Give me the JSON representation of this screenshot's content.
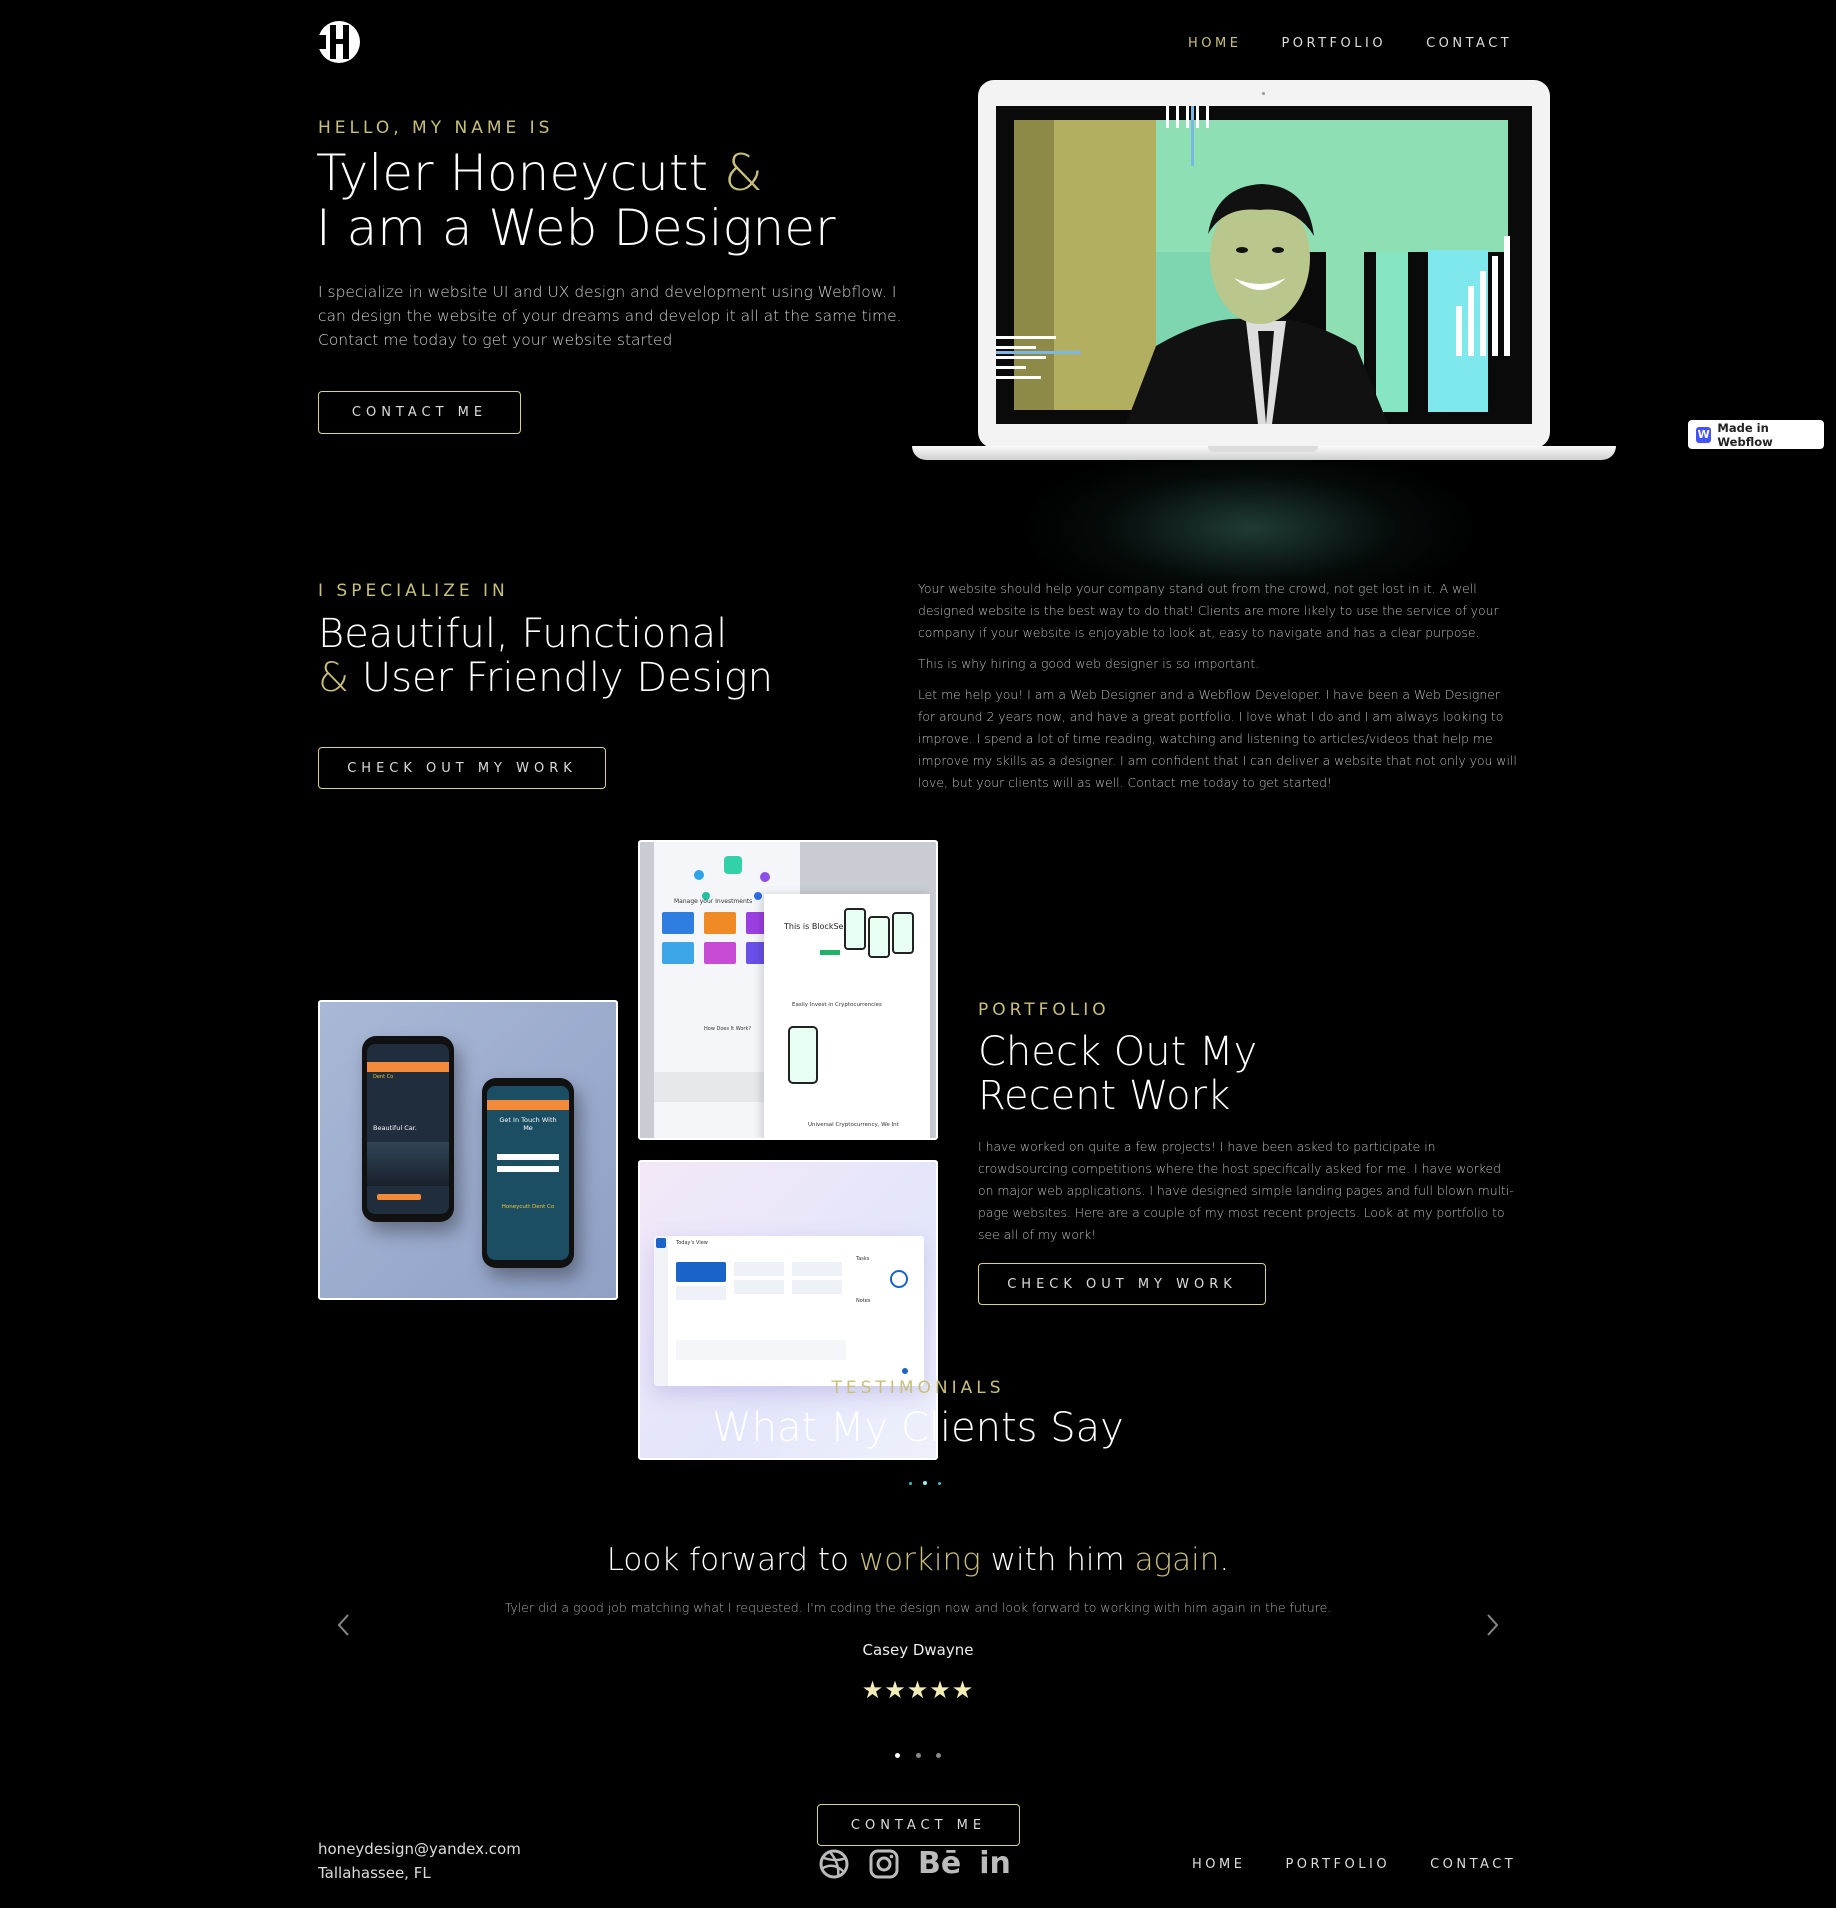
{
  "colors": {
    "background": "#000000",
    "accent": "#c8c07a",
    "button_border": "#d8d18a",
    "photo_green": "#8ee0b4",
    "photo_olive": "#b2b060"
  },
  "nav": {
    "logo_icon": "monogram-logo",
    "items": [
      {
        "label": "HOME",
        "active": true
      },
      {
        "label": "PORTFOLIO",
        "active": false
      },
      {
        "label": "CONTACT",
        "active": false
      }
    ]
  },
  "hero": {
    "eyebrow": "HELLO, MY NAME IS",
    "title_line1": "Tyler Honeycutt",
    "title_amp": "&",
    "title_line2": "I am a Web Designer",
    "intro": "I specialize in website UI and UX design and development using Webflow. I can design the website of your dreams and develop it all at the same time. Contact me today to get your website started",
    "cta": "CONTACT ME"
  },
  "webflow_badge": {
    "icon": "webflow-w-icon",
    "label": "Made in Webflow"
  },
  "specialize": {
    "eyebrow": "I SPECIALIZE IN",
    "title_line1": "Beautiful, Functional",
    "title_amp": "&",
    "title_line2": "User Friendly Design",
    "cta": "CHECK OUT MY WORK",
    "paragraphs": [
      "Your website should help your company stand out from the crowd, not get lost in it. A well designed website is the best way to do that! Clients are more likely to use the service of your company if your website is enjoyable to look at, easy to navigate and has a clear purpose.",
      "This is why hiring a good web designer is so important.",
      "Let me help you! I am a Web Designer and a Webflow Developer. I have been a Web Designer for around 2 years now, and have a great portfolio. I love what I do and I am always looking to improve. I spend a lot of time reading, watching and listening to articles/videos that help me improve my skills as a designer. I am confident that I can deliver a website that not only you will love, but your clients will as well. Contact me today to get started!"
    ]
  },
  "portfolio": {
    "eyebrow": "PORTFOLIO",
    "title_line1": "Check Out My",
    "title_line2": "Recent Work",
    "body": "I have worked on quite a few projects! I have been asked to participate in crowdsourcing competitions where the host specifically asked for me. I have worked on major web applications. I have designed simple landing pages and full blown multi-page websites. Here are a couple of my most recent projects. Look at my portfolio to see all of my work!",
    "cta": "CHECK OUT MY WORK",
    "card_blocksense": {
      "headline": "This is BlockSense",
      "sub1": "Manage your Investments",
      "sub2": "Easily Invest in Cryptocurrencies",
      "sub3": "How Does It Work?",
      "sub4": "Universal Cryptocurrency, We Int"
    },
    "card_phones": {
      "phone1_line1": "Honeycutt",
      "phone1_line2": "Dent Co",
      "phone1_text": "Beautiful Car.",
      "phone2_text": "Get In Touch With Me",
      "phone2_logo": "Honeycutt Dent Co"
    },
    "card_dashboard": {
      "title": "Today's View",
      "side": "Tasks",
      "notes": "Notes"
    }
  },
  "testimonials": {
    "eyebrow": "TESTIMONIALS",
    "title": "What My Clients Say",
    "quote_w1": "Look forward to",
    "quote_w2": "working",
    "quote_w3": "with him",
    "quote_w4": "again",
    "quote_w5": ".",
    "body": "Tyler did a good job matching what I requested. I'm coding the design now and look forward to working with him again in the future.",
    "author": "Casey Dwayne",
    "stars": "★★★★★",
    "rating": 5,
    "prev_icon": "chevron-left-icon",
    "next_icon": "chevron-right-icon",
    "slide_count": 3,
    "active_slide": 1
  },
  "footer": {
    "cta": "CONTACT ME",
    "email": "honeydesign@yandex.com",
    "location": "Tallahassee, FL",
    "social": [
      "dribbble-icon",
      "instagram-icon",
      "behance-icon",
      "linkedin-icon"
    ],
    "behance_text": "Bē",
    "linkedin_text": "in",
    "nav": [
      "HOME",
      "PORTFOLIO",
      "CONTACT"
    ]
  }
}
